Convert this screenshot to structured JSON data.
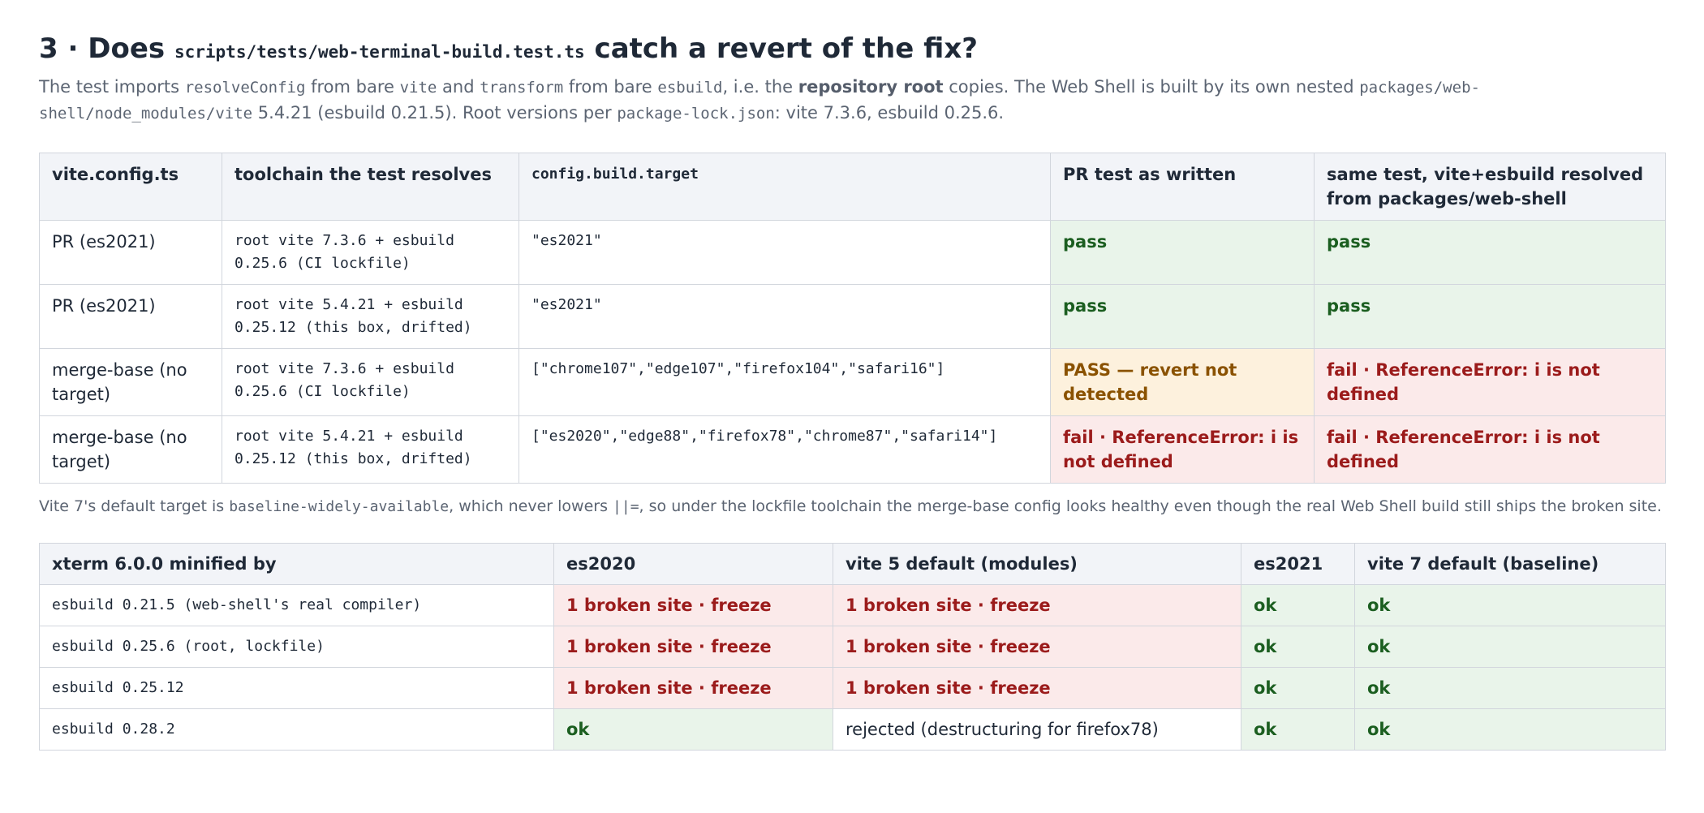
{
  "heading": {
    "prefix": "3 · Does ",
    "path": "scripts/tests/web-terminal-build.test.ts",
    "suffix": " catch a revert of the fix?"
  },
  "intro": {
    "t1": "The test imports ",
    "c1": "resolveConfig",
    "t2": " from bare ",
    "c2": "vite",
    "t3": " and ",
    "c3": "transform",
    "t4": " from bare ",
    "c4": "esbuild",
    "t5": ", i.e. the ",
    "b1": "repository root",
    "t6": " copies. The Web Shell is built by its own nested ",
    "c5": "packages/web-shell/node_modules/vite",
    "t7": " 5.4.21 (esbuild 0.21.5). Root versions per ",
    "c6": "package-lock.json",
    "t8": ": vite 7.3.6, esbuild 0.25.6."
  },
  "table1": {
    "headers": [
      "vite.config.ts",
      "toolchain the test resolves",
      "config.build.target",
      "PR test as written",
      "same test, vite+esbuild resolved from packages/web-shell"
    ],
    "rows": [
      [
        "PR (es2021)",
        "root vite 7.3.6 + esbuild 0.25.6 (CI lockfile)",
        "\"es2021\"",
        "pass",
        "pass"
      ],
      [
        "PR (es2021)",
        "root vite 5.4.21 + esbuild 0.25.12 (this box, drifted)",
        "\"es2021\"",
        "pass",
        "pass"
      ],
      [
        "merge-base (no target)",
        "root vite 7.3.6 + esbuild 0.25.6 (CI lockfile)",
        "[\"chrome107\",\"edge107\",\"firefox104\",\"safari16\"]",
        "PASS — revert not detected",
        "fail · ReferenceError: i is not defined"
      ],
      [
        "merge-base (no target)",
        "root vite 5.4.21 + esbuild 0.25.12 (this box, drifted)",
        "[\"es2020\",\"edge88\",\"firefox78\",\"chrome87\",\"safari14\"]",
        "fail · ReferenceError: i is not defined",
        "fail · ReferenceError: i is not defined"
      ]
    ]
  },
  "note": {
    "t1": "Vite 7's default target is ",
    "c1": "baseline-widely-available",
    "t2": ", which never lowers ",
    "c2": "||=",
    "t3": ", so under the lockfile toolchain the merge-base config looks healthy even though the real Web Shell build still ships the broken site."
  },
  "table2": {
    "headers": [
      "xterm 6.0.0 minified by",
      "es2020",
      "vite 5 default (modules)",
      "es2021",
      "vite 7 default (baseline)"
    ],
    "rows": [
      [
        "esbuild 0.21.5 (web-shell's real compiler)",
        "1 broken site · freeze",
        "1 broken site · freeze",
        "ok",
        "ok"
      ],
      [
        "esbuild 0.25.6 (root, lockfile)",
        "1 broken site · freeze",
        "1 broken site · freeze",
        "ok",
        "ok"
      ],
      [
        "esbuild 0.25.12",
        "1 broken site · freeze",
        "1 broken site · freeze",
        "ok",
        "ok"
      ],
      [
        "esbuild 0.28.2",
        "ok",
        "rejected (destructuring for firefox78)",
        "ok",
        "ok"
      ]
    ]
  },
  "colors": {
    "pass_bg": "#e9f4ea",
    "pass_text": "#1b5e20",
    "fail_bg": "#fbeaea",
    "fail_text": "#9b1b1b",
    "warn_bg": "#fdf1dd",
    "warn_text": "#8a5200",
    "header_bg": "#f2f4f8"
  }
}
